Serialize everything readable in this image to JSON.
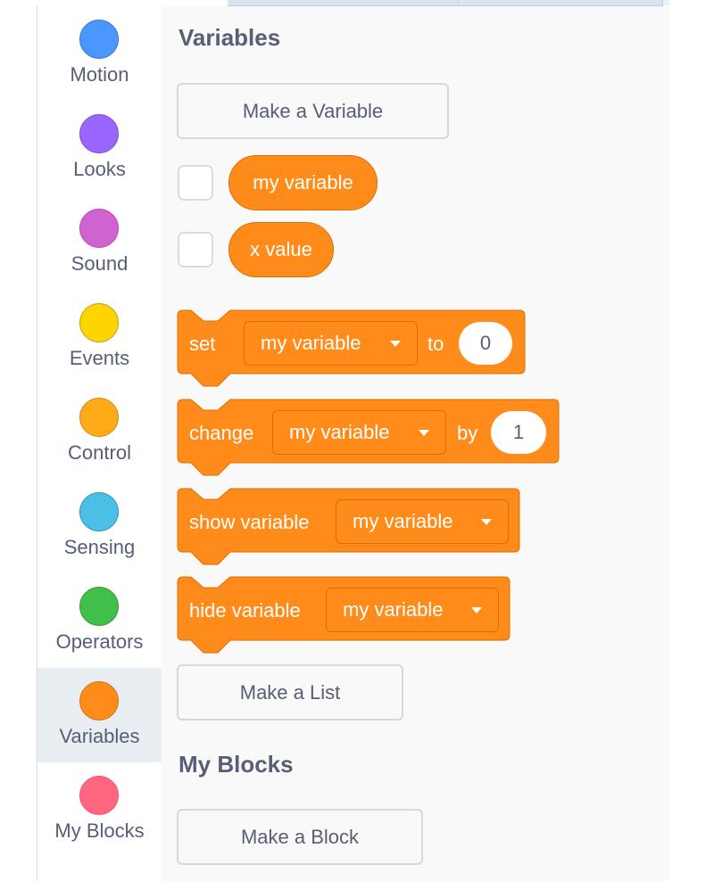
{
  "categories": [
    {
      "label": "Motion",
      "color": "#4c97ff",
      "border": "#3373cc"
    },
    {
      "label": "Looks",
      "color": "#9966ff",
      "border": "#774dcb"
    },
    {
      "label": "Sound",
      "color": "#cf63cf",
      "border": "#bd42bd"
    },
    {
      "label": "Events",
      "color": "#ffd500",
      "border": "#cc9900"
    },
    {
      "label": "Control",
      "color": "#ffab19",
      "border": "#cf8b17"
    },
    {
      "label": "Sensing",
      "color": "#4cbfe6",
      "border": "#2e8eb8"
    },
    {
      "label": "Operators",
      "color": "#40bf4a",
      "border": "#389438"
    },
    {
      "label": "Variables",
      "color": "#ff8c1a",
      "border": "#db6e00",
      "selected": true
    },
    {
      "label": "My Blocks",
      "color": "#ff6680",
      "border": "#ff4d6a"
    }
  ],
  "flyout": {
    "variables_heading": "Variables",
    "make_variable_label": "Make a Variable",
    "variables": [
      {
        "name": "my variable",
        "checked": false
      },
      {
        "name": "x value",
        "checked": false
      }
    ],
    "blocks": {
      "set": {
        "label": "set",
        "variable": "my variable",
        "connector": "to",
        "value": "0"
      },
      "change": {
        "label": "change",
        "variable": "my variable",
        "connector": "by",
        "value": "1"
      },
      "show": {
        "label": "show variable",
        "variable": "my variable"
      },
      "hide": {
        "label": "hide variable",
        "variable": "my variable"
      }
    },
    "make_list_label": "Make a List",
    "myblocks_heading": "My Blocks",
    "make_block_label": "Make a Block"
  },
  "colors": {
    "variables_block": "#ff8c1a",
    "variables_block_border": "#db6e00",
    "text_primary": "#575e75"
  }
}
